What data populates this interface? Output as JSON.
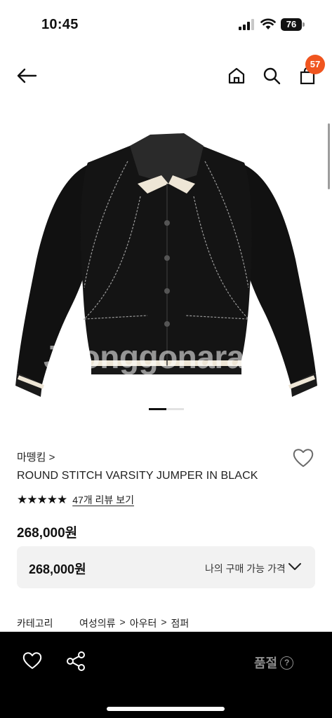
{
  "status_bar": {
    "time": "10:45",
    "battery": "76"
  },
  "nav": {
    "cart_count": "57"
  },
  "image": {
    "watermark": "Joonggonara",
    "page_indicator": {
      "current": 1,
      "total": 2
    }
  },
  "product": {
    "brand": "마뗑킴 >",
    "name": "ROUND STITCH VARSITY JUMPER IN BLACK",
    "rating": 5,
    "stars": "★★★★★",
    "reviews_label": "47개 리뷰 보기",
    "price": "268,000원"
  },
  "price_box": {
    "value": "268,000원",
    "label": "나의 구매 가능 가격"
  },
  "category": {
    "label": "카테고리",
    "path": [
      "여성의류",
      "아우터",
      "점퍼"
    ],
    "separator": ">"
  },
  "bottom_bar": {
    "status": "품절",
    "help": "?"
  },
  "colors": {
    "accent": "#f0551f",
    "bottom_bar": "#000000",
    "price_box": "#f2f2f2"
  }
}
